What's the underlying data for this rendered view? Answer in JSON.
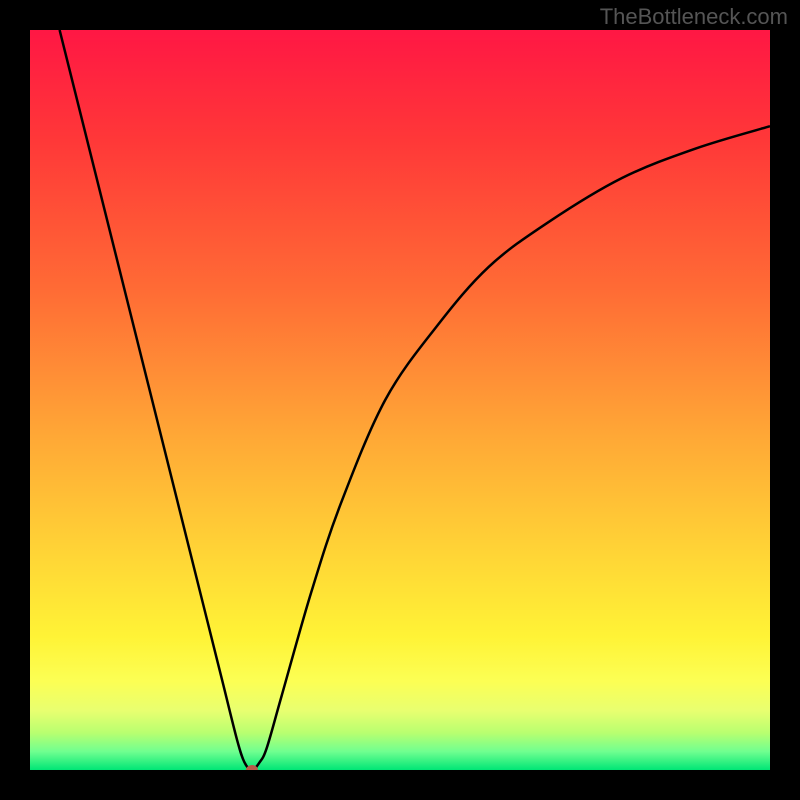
{
  "watermark": "TheBottleneck.com",
  "chart_data": {
    "type": "line",
    "title": "",
    "xlabel": "",
    "ylabel": "",
    "xlim": [
      0,
      100
    ],
    "ylim": [
      0,
      100
    ],
    "grid": false,
    "background": "red-orange-yellow-green-gradient",
    "series": [
      {
        "name": "bottleneck-curve",
        "type": "line",
        "color": "#000000",
        "x": [
          4,
          8,
          12,
          16,
          20,
          24,
          26,
          28,
          29,
          30,
          31,
          32,
          34,
          38,
          42,
          48,
          55,
          62,
          70,
          80,
          90,
          100
        ],
        "y": [
          100,
          84,
          68,
          52,
          36,
          20,
          12,
          4,
          1,
          0,
          1,
          3,
          10,
          24,
          36,
          50,
          60,
          68,
          74,
          80,
          84,
          87
        ]
      }
    ],
    "marker": {
      "x": 30,
      "y": 0,
      "color": "#b85c4a"
    },
    "gradient_stops": [
      {
        "offset": 0,
        "color": "#ff1744"
      },
      {
        "offset": 15,
        "color": "#ff3838"
      },
      {
        "offset": 35,
        "color": "#ff6b35"
      },
      {
        "offset": 55,
        "color": "#ffa836"
      },
      {
        "offset": 72,
        "color": "#ffd836"
      },
      {
        "offset": 82,
        "color": "#fff336"
      },
      {
        "offset": 88,
        "color": "#fcff54"
      },
      {
        "offset": 92,
        "color": "#e8ff70"
      },
      {
        "offset": 95,
        "color": "#b8ff70"
      },
      {
        "offset": 97.5,
        "color": "#70ff90"
      },
      {
        "offset": 100,
        "color": "#00e676"
      }
    ]
  }
}
